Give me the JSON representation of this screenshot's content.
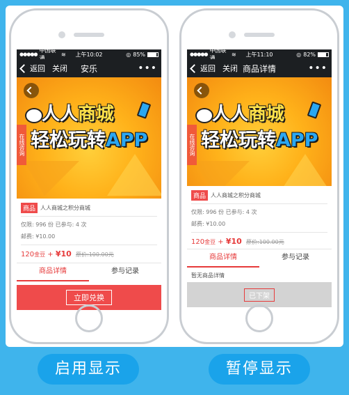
{
  "colors": {
    "accent_red": "#ef4b4b",
    "brand_blue": "#1aa3ea"
  },
  "phones": [
    {
      "status": {
        "carrier": "中国联通",
        "time": "上午10:02",
        "battery": "85%",
        "battery_level": 0.85
      },
      "nav": {
        "back": "返回",
        "close": "关闭",
        "title": "安乐",
        "more": "•••"
      },
      "banner": {
        "line1a": "人人",
        "line1b": "商城",
        "line2a": "轻松玩转",
        "line2b": "APP",
        "consult": "在线咨询"
      },
      "product": {
        "tag": "商品",
        "name": "人人商城之积分商城"
      },
      "meta": {
        "limit": "仅限: 996 份 已参与: 4 次",
        "postage": "邮费: ¥10.00"
      },
      "price": {
        "gold": "120",
        "gold_unit": "金豆",
        "plus": "+",
        "cash": "¥10",
        "orig": "原价:100.00元"
      },
      "tabs": [
        "商品详情",
        "参与记录"
      ],
      "action": "立即兑换"
    },
    {
      "status": {
        "carrier": "中国联通",
        "time": "上午11:10",
        "battery": "82%",
        "battery_level": 0.82
      },
      "nav": {
        "back": "返回",
        "close": "关闭",
        "title": "商品详情",
        "more": "•••"
      },
      "banner": {
        "line1a": "人人",
        "line1b": "商城",
        "line2a": "轻松玩转",
        "line2b": "APP",
        "consult": "在线咨询"
      },
      "product": {
        "tag": "商品",
        "name": "人人商城之积分商城"
      },
      "meta": {
        "limit": "仅限: 996 份 已参与: 4 次",
        "postage": "邮费: ¥10.00"
      },
      "price": {
        "gold": "120",
        "gold_unit": "金豆",
        "plus": "+",
        "cash": "¥10",
        "orig": "原价:100.00元"
      },
      "tabs": [
        "商品详情",
        "参与记录"
      ],
      "no_detail": "暂无商品详情",
      "action": "已下架"
    }
  ],
  "labels": {
    "left": "启用显示",
    "right": "暂停显示"
  }
}
